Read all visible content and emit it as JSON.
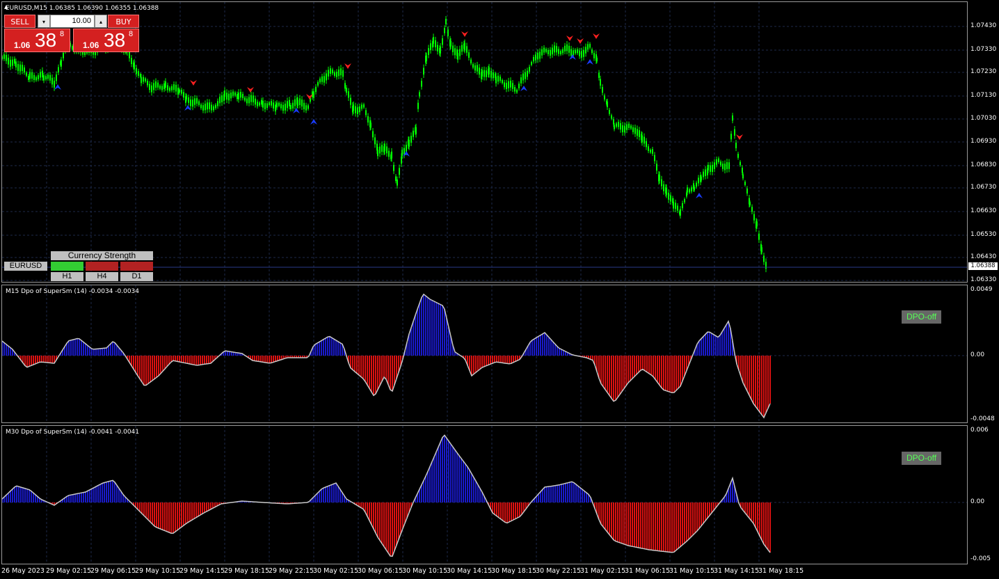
{
  "chart": {
    "symbol_info": "EURUSD,M15  1.06385 1.06390 1.06355 1.06388",
    "price_ticks": [
      "1.07430",
      "1.07330",
      "1.07230",
      "1.07130",
      "1.07030",
      "1.06930",
      "1.06830",
      "1.06730",
      "1.06630",
      "1.06530",
      "1.06430",
      "1.06330"
    ],
    "current_price": "1.06388",
    "time_labels": [
      "26 May 2023",
      "29 May 02:15",
      "29 May 06:15",
      "29 May 10:15",
      "29 May 14:15",
      "29 May 18:15",
      "29 May 22:15",
      "30 May 02:15",
      "30 May 06:15",
      "30 May 10:15",
      "30 May 14:15",
      "30 May 18:15",
      "30 May 22:15",
      "31 May 02:15",
      "31 May 06:15",
      "31 May 10:15",
      "31 May 14:15",
      "31 May 18:15"
    ],
    "colors": {
      "candle": "#00ff00",
      "grid": "#1e2a4a",
      "up_arrow": "#1a3cff",
      "down_arrow": "#ff2020"
    }
  },
  "trade_panel": {
    "sell_label": "SELL",
    "buy_label": "BUY",
    "lot_value": "10.00",
    "down_icon": "▾",
    "up_icon": "▴",
    "sell_price_prefix": "1.06",
    "sell_price_big": "38",
    "sell_price_sup": "8",
    "buy_price_prefix": "1.06",
    "buy_price_big": "38",
    "buy_price_sup": "8"
  },
  "currency_strength": {
    "title": "Currency Strength",
    "symbol": "EURUSD",
    "timeframes": [
      "H1",
      "H4",
      "D1"
    ],
    "cell_colors": [
      "#33cc33",
      "#b22222",
      "#b22222"
    ]
  },
  "dpo_m15": {
    "title": "M15 Dpo of SuperSm (14) -0.0034 -0.0034",
    "ticks": [
      "0.0049",
      "0.00",
      "-0.0048"
    ],
    "button": "DPO-off",
    "colors": {
      "positive": "#1a1acc",
      "negative": "#dd1111",
      "line": "#c8c8c8"
    }
  },
  "dpo_m30": {
    "title": "M30 Dpo of SuperSm (14) -0.0041 -0.0041",
    "ticks": [
      "0.006",
      "0.00",
      "-0.005"
    ],
    "button": "DPO-off",
    "colors": {
      "positive": "#1a1acc",
      "negative": "#dd1111",
      "line": "#c8c8c8"
    }
  }
}
